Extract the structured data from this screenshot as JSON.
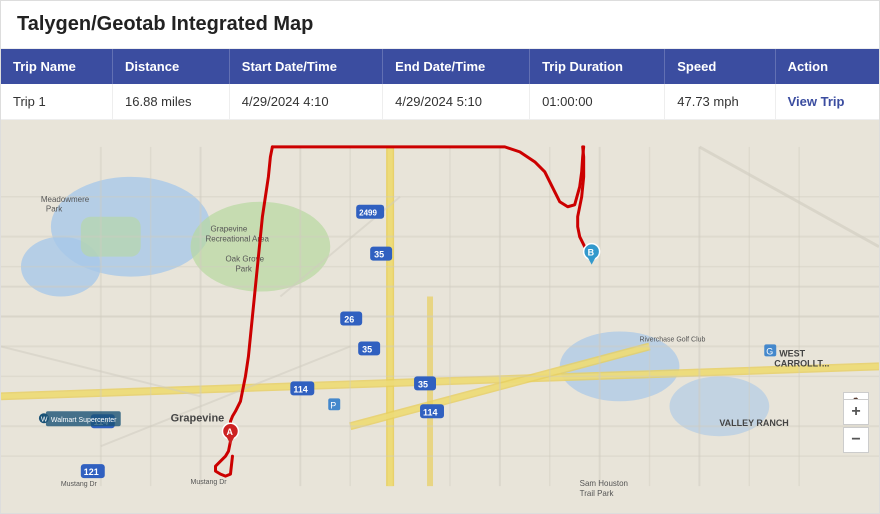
{
  "app": {
    "title": "Talygen/Geotab Integrated Map"
  },
  "table": {
    "columns": [
      {
        "key": "trip_name",
        "label": "Trip Name"
      },
      {
        "key": "distance",
        "label": "Distance"
      },
      {
        "key": "start_datetime",
        "label": "Start Date/Time"
      },
      {
        "key": "end_datetime",
        "label": "End Date/Time"
      },
      {
        "key": "trip_duration",
        "label": "Trip Duration"
      },
      {
        "key": "speed",
        "label": "Speed"
      },
      {
        "key": "action",
        "label": "Action"
      }
    ],
    "rows": [
      {
        "trip_name": "Trip 1",
        "distance": "16.88 miles",
        "start_datetime": "4/29/2024 4:10",
        "end_datetime": "4/29/2024 5:10",
        "trip_duration": "01:00:00",
        "speed": "47.73 mph",
        "action_label": "View Trip"
      }
    ]
  },
  "map": {
    "zoom_in_label": "+",
    "zoom_out_label": "−",
    "person_icon": "🧍"
  }
}
